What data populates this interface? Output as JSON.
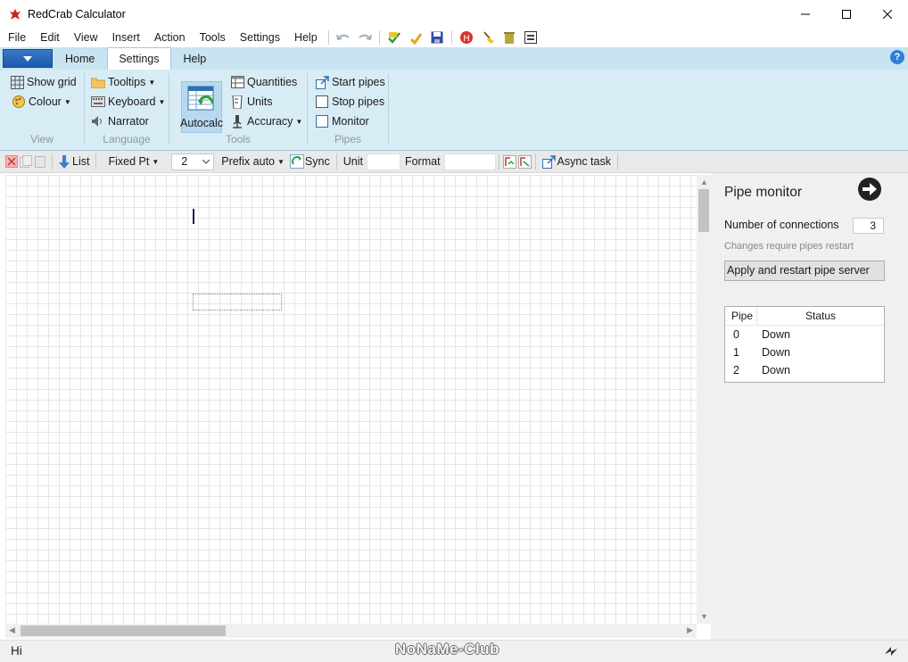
{
  "window": {
    "title": "RedCrab Calculator"
  },
  "menu": {
    "items": [
      "File",
      "Edit",
      "View",
      "Insert",
      "Action",
      "Tools",
      "Settings",
      "Help"
    ]
  },
  "ribbon": {
    "tabs": [
      "Home",
      "Settings",
      "Help"
    ],
    "active_tab": "Settings",
    "groups": {
      "view": {
        "label": "View",
        "show_grid": "Show grid",
        "colour": "Colour"
      },
      "language": {
        "label": "Language",
        "tooltips": "Tooltips",
        "keyboard": "Keyboard",
        "narrator": "Narrator"
      },
      "tools": {
        "label": "Tools",
        "autocalc": "Autocalc",
        "quantities": "Quantities",
        "units": "Units",
        "accuracy": "Accuracy"
      },
      "pipes": {
        "label": "Pipes",
        "start_pipes": "Start pipes",
        "stop_pipes": "Stop pipes",
        "monitor": "Monitor"
      }
    }
  },
  "toolbar": {
    "list": "List",
    "fixed_pt": "Fixed Pt",
    "precision_value": "2",
    "prefix": "Prefix auto",
    "sync": "Sync",
    "unit_label": "Unit",
    "unit_value": "",
    "format_label": "Format",
    "format_value": "",
    "async_task": "Async task"
  },
  "pipe_monitor": {
    "title": "Pipe monitor",
    "connections_label": "Number of connections",
    "connections_value": "3",
    "hint": "Changes require pipes restart",
    "apply_button": "Apply and restart pipe server",
    "table": {
      "headers": [
        "Pipe",
        "Status"
      ],
      "rows": [
        {
          "pipe": "0",
          "status": "Down"
        },
        {
          "pipe": "1",
          "status": "Down"
        },
        {
          "pipe": "2",
          "status": "Down"
        }
      ]
    }
  },
  "status": {
    "text": "Hi",
    "watermark": "NoNaMe-Club"
  },
  "colors": {
    "ribbon_bg": "#d8ecf5",
    "tab_bar_bg": "#c7e4f0",
    "app_button": "#1c5aab"
  }
}
